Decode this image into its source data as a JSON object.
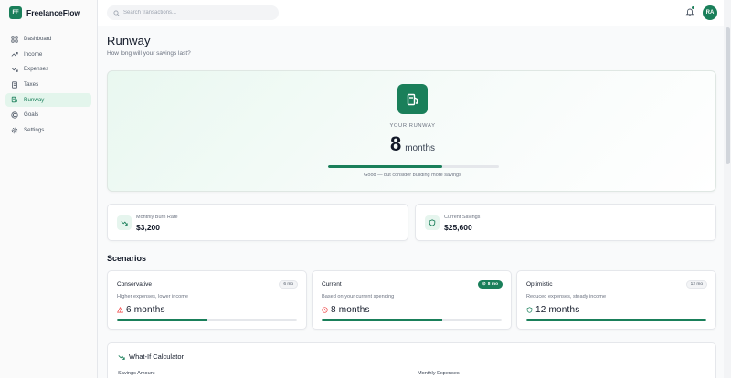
{
  "brand": {
    "logo": "FF",
    "name": "FreelanceFlow",
    "accent": "#1a7f5a"
  },
  "sidebar": {
    "items": [
      {
        "label": "Dashboard",
        "icon": "grid-icon",
        "active": false
      },
      {
        "label": "Income",
        "icon": "trend-up-icon",
        "active": false
      },
      {
        "label": "Expenses",
        "icon": "trend-down-icon",
        "active": false
      },
      {
        "label": "Taxes",
        "icon": "receipt-icon",
        "active": false
      },
      {
        "label": "Runway",
        "icon": "fuel-icon",
        "active": true
      },
      {
        "label": "Goals",
        "icon": "target-icon",
        "active": false
      },
      {
        "label": "Settings",
        "icon": "gear-icon",
        "active": false
      }
    ]
  },
  "topbar": {
    "search_placeholder": "Search transactions...",
    "avatar_initials": "RA"
  },
  "page": {
    "title": "Runway",
    "subtitle": "How long will your savings last?"
  },
  "hero": {
    "label": "YOUR RUNWAY",
    "value": "8",
    "unit": "months",
    "progress_fraction": 0.67,
    "note": "Good — but consider building more savings"
  },
  "stats": [
    {
      "label": "Monthly Burn Rate",
      "value": "$3,200",
      "icon": "trend-down-icon"
    },
    {
      "label": "Current Savings",
      "value": "$25,600",
      "icon": "shield-icon"
    }
  ],
  "scenarios_title": "Scenarios",
  "scenarios": [
    {
      "name": "Conservative",
      "badge": "6 mo",
      "current": false,
      "description": "Higher expenses, lower income",
      "value": "6 months",
      "icon": "alert-triangle-icon",
      "icon_color": "#ef4444",
      "progress_fraction": 0.5
    },
    {
      "name": "Current",
      "badge": "8 mo",
      "current": true,
      "description": "Based on your current spending",
      "value": "8 months",
      "icon": "clock-icon",
      "icon_color": "#ef4444",
      "progress_fraction": 0.67
    },
    {
      "name": "Optimistic",
      "badge": "12 mo",
      "current": false,
      "description": "Reduced expenses, steady income",
      "value": "12 months",
      "icon": "shield-icon",
      "icon_color": "#1a7f5a",
      "progress_fraction": 1.0
    }
  ],
  "calculator": {
    "title": "What-If Calculator",
    "savings_label": "Savings Amount",
    "expenses_label": "Monthly Expenses"
  }
}
